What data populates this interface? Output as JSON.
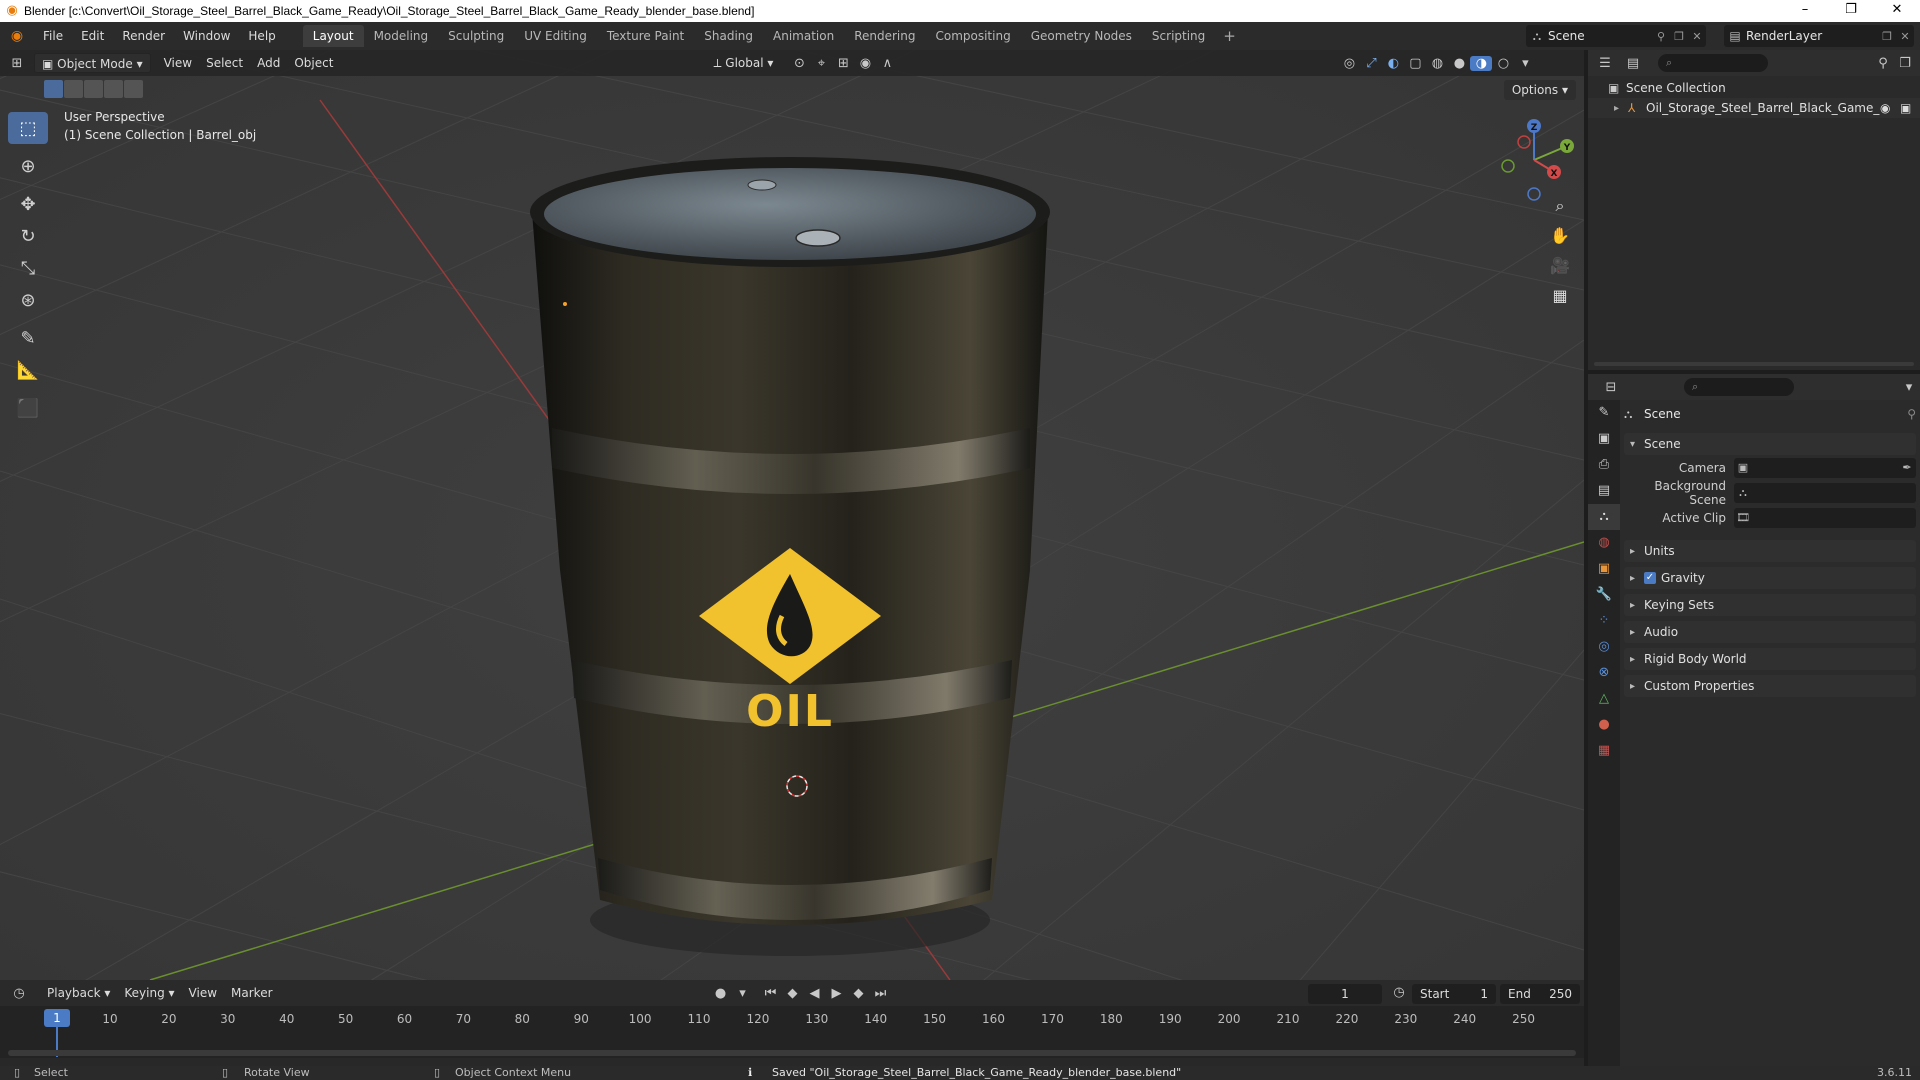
{
  "window": {
    "title": "Blender [c:\\Convert\\Oil_Storage_Steel_Barrel_Black_Game_Ready\\Oil_Storage_Steel_Barrel_Black_Game_Ready_blender_base.blend]",
    "minimize": "–",
    "maximize": "❐",
    "close": "✕"
  },
  "menu": {
    "items": [
      "File",
      "Edit",
      "Render",
      "Window",
      "Help"
    ],
    "workspaces": [
      "Layout",
      "Modeling",
      "Sculpting",
      "UV Editing",
      "Texture Paint",
      "Shading",
      "Animation",
      "Rendering",
      "Compositing",
      "Geometry Nodes",
      "Scripting"
    ],
    "active_workspace": "Layout",
    "add_workspace": "+",
    "scene": "Scene",
    "view_layer": "RenderLayer"
  },
  "viewport": {
    "mode": "Object Mode",
    "menus": [
      "View",
      "Select",
      "Add",
      "Object"
    ],
    "transform_orientation": "Global",
    "options_label": "Options",
    "overlay_line1": "User Perspective",
    "overlay_line2": "(1) Scene Collection | Barrel_obj",
    "barrel_label": "OIL",
    "gizmo": {
      "z": "Z",
      "y": "Y",
      "x": "X"
    }
  },
  "timeline": {
    "menus": [
      "Playback",
      "Keying",
      "View",
      "Marker"
    ],
    "current_frame": "1",
    "start_label": "Start",
    "start": "1",
    "end_label": "End",
    "end": "250",
    "ticks": [
      "10",
      "20",
      "30",
      "40",
      "50",
      "60",
      "70",
      "80",
      "90",
      "100",
      "110",
      "120",
      "130",
      "140",
      "150",
      "160",
      "170",
      "180",
      "190",
      "200",
      "210",
      "220",
      "230",
      "240",
      "250"
    ]
  },
  "outliner": {
    "collection": "Scene Collection",
    "object": "Oil_Storage_Steel_Barrel_Black_Game_I"
  },
  "properties": {
    "breadcrumb": "Scene",
    "panel_scene": "Scene",
    "camera_label": "Camera",
    "background_label": "Background Scene",
    "clip_label": "Active Clip",
    "panels": [
      "Units",
      "Gravity",
      "Keying Sets",
      "Audio",
      "Rigid Body World",
      "Custom Properties"
    ],
    "gravity_checked": true
  },
  "status": {
    "select": "Select",
    "rotate": "Rotate View",
    "context": "Object Context Menu",
    "message": "Saved \"Oil_Storage_Steel_Barrel_Black_Game_Ready_blender_base.blend\"",
    "version": "3.6.11"
  },
  "colors": {
    "accent": "#4a7bc4",
    "barrel_logo": "#f2c12e",
    "x_axis": "#b83a3a",
    "y_axis": "#7aa83a"
  }
}
